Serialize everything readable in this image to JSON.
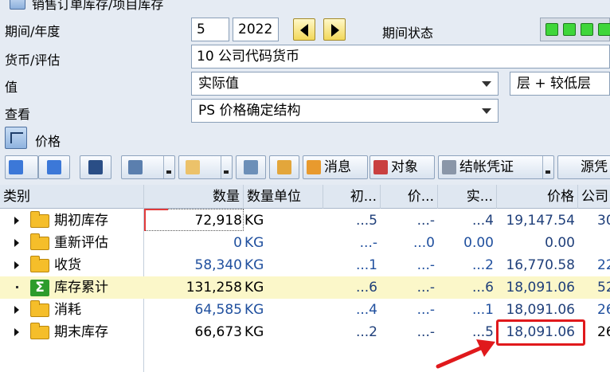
{
  "title": "销售订单库存/项目库存",
  "period": {
    "label": "期间/年度",
    "period_value": "5",
    "year_value": "2022",
    "status_label": "期间状态"
  },
  "currency": {
    "label": "货币/评估",
    "value": "10 公司代码货币"
  },
  "value_row": {
    "label": "值",
    "value": "实际值",
    "level": "层 + 较低层"
  },
  "view_row": {
    "label": "查看",
    "value": "PS 价格确定结构"
  },
  "section": {
    "label": "价格"
  },
  "toolbar": {
    "messages": "消息",
    "objects": "对象",
    "closing_doc": "结帐凭证",
    "source": "源凭"
  },
  "grid": {
    "headers": [
      "类别",
      "数量",
      "数量单位",
      "初...",
      "价...",
      "实...",
      "价格",
      "公司"
    ],
    "rows": [
      {
        "name": "期初库存",
        "qty": "72,918",
        "unit": "KG",
        "c1": "...5",
        "c2": "...-",
        "c3": "...4",
        "price": "19,147.54",
        "co": "30"
      },
      {
        "name": "重新评估",
        "qty": "0",
        "unit": "KG",
        "c1": "...-",
        "c2": "...0",
        "c3": "0.00",
        "price": "0.00",
        "co": ""
      },
      {
        "name": "收货",
        "qty": "58,340",
        "unit": "KG",
        "c1": "...1",
        "c2": "...-",
        "c3": "...2",
        "price": "16,770.58",
        "co": "22"
      },
      {
        "name": "库存累计",
        "qty": "131,258",
        "unit": "KG",
        "c1": "...6",
        "c2": "...-",
        "c3": "...6",
        "price": "18,091.06",
        "co": "52"
      },
      {
        "name": "消耗",
        "qty": "64,585",
        "unit": "KG",
        "c1": "...4",
        "c2": "...-",
        "c3": "...1",
        "price": "18,091.06",
        "co": "26"
      },
      {
        "name": "期末库存",
        "qty": "66,673",
        "unit": "KG",
        "c1": "...2",
        "c2": "...-",
        "c3": "...5",
        "price": "18,091.06",
        "co": "26"
      }
    ]
  }
}
